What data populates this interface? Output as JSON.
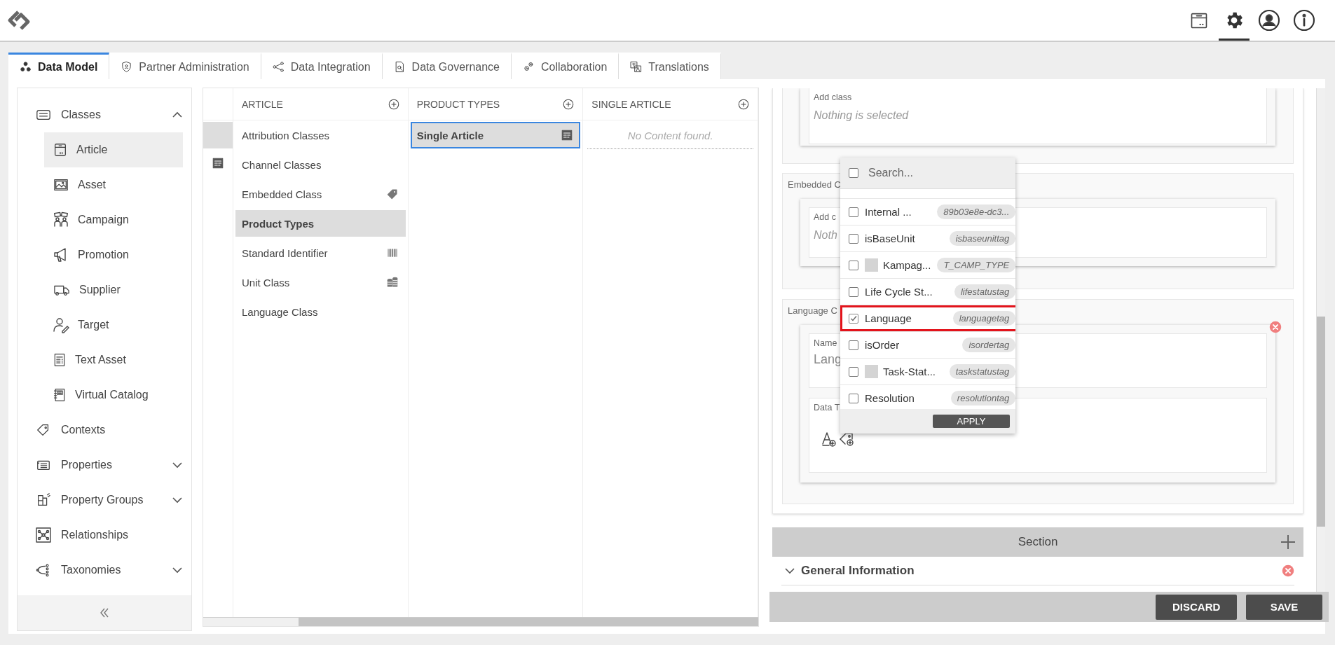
{
  "toolbar": [
    {
      "selected": false
    },
    {
      "selected": true
    },
    {
      "selected": false
    },
    {
      "selected": false
    }
  ],
  "tabs": [
    {
      "label": "Data Model",
      "selected": true
    },
    {
      "label": "Partner Administration",
      "selected": false
    },
    {
      "label": "Data Integration",
      "selected": false
    },
    {
      "label": "Data Governance",
      "selected": false
    },
    {
      "label": "Collaboration",
      "selected": false
    },
    {
      "label": "Translations",
      "selected": false
    }
  ],
  "sidebar": {
    "items": [
      {
        "label": "Classes",
        "selected": false,
        "expanded": true,
        "children": [
          {
            "label": "Article",
            "selected": true
          },
          {
            "label": "Asset",
            "selected": false
          },
          {
            "label": "Campaign",
            "selected": false
          },
          {
            "label": "Promotion",
            "selected": false
          },
          {
            "label": "Supplier",
            "selected": false
          },
          {
            "label": "Target",
            "selected": false
          },
          {
            "label": "Text Asset",
            "selected": false
          },
          {
            "label": "Virtual Catalog",
            "selected": false
          }
        ]
      },
      {
        "label": "Contexts",
        "selected": false
      },
      {
        "label": "Properties",
        "selected": false,
        "expanded": false
      },
      {
        "label": "Property Groups",
        "selected": false,
        "expanded": false
      },
      {
        "label": "Relationships",
        "selected": false
      },
      {
        "label": "Taxonomies",
        "selected": false,
        "expanded": false
      }
    ]
  },
  "gutter": [
    {
      "selected": true
    },
    {
      "selected": false
    }
  ],
  "columns": [
    {
      "header": "ARTICLE",
      "items": [
        {
          "label": "Attribution Classes",
          "selected": false
        },
        {
          "label": "Channel Classes",
          "selected": false
        },
        {
          "label": "Embedded Class",
          "selected": false
        },
        {
          "label": "Product Types",
          "selected": true
        },
        {
          "label": "Standard Identifier",
          "selected": false
        },
        {
          "label": "Unit Class",
          "selected": false
        },
        {
          "label": "Language Class",
          "selected": false
        }
      ]
    },
    {
      "header": "PRODUCT TYPES",
      "items": [
        {
          "label": "Single Article",
          "selected": true
        }
      ]
    },
    {
      "header": "SINGLE ARTICLE",
      "empty_text": "No Content found."
    }
  ],
  "form": {
    "add_class": {
      "label": "Add class",
      "placeholder": "Nothing is selected"
    },
    "embedded": {
      "title": "Embedded C",
      "label": "Add c",
      "placeholder": "Noth"
    },
    "language": {
      "title": "Language C",
      "name_label": "Name",
      "name_value": "Lang",
      "data_label": "Data T"
    }
  },
  "dropdown": {
    "select_all_checked": false,
    "placeholder": "Search...",
    "apply": "APPLY",
    "options": [
      {
        "label": "Internal ...",
        "tag": "89b03e8e-dc3...",
        "checked": false,
        "swatch": false,
        "highlighted": false
      },
      {
        "label": "isBaseUnit",
        "tag": "isbaseunittag",
        "checked": false,
        "swatch": false,
        "highlighted": false
      },
      {
        "label": "Kampag...",
        "tag": "T_CAMP_TYPE",
        "checked": false,
        "swatch": true,
        "highlighted": false
      },
      {
        "label": "Life Cycle St...",
        "tag": "lifestatustag",
        "checked": false,
        "swatch": false,
        "highlighted": false
      },
      {
        "label": "Language",
        "tag": "languagetag",
        "checked": true,
        "swatch": false,
        "highlighted": true
      },
      {
        "label": "isOrder",
        "tag": "isordertag",
        "checked": false,
        "swatch": false,
        "highlighted": false
      },
      {
        "label": "Task-Stat...",
        "tag": "taskstatustag",
        "checked": false,
        "swatch": true,
        "highlighted": false
      },
      {
        "label": "Resolution",
        "tag": "resolutiontag",
        "checked": false,
        "swatch": false,
        "highlighted": false
      }
    ]
  },
  "section": {
    "title": "Section"
  },
  "groups": [
    {
      "label": "General Information",
      "expanded": true
    }
  ],
  "footer_buttons": [
    "DISCARD",
    "SAVE"
  ]
}
